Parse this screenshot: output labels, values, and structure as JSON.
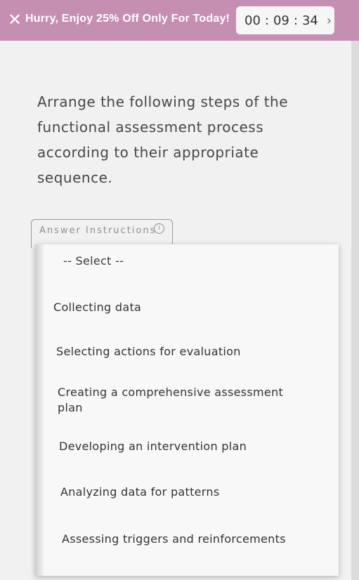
{
  "banner": {
    "close_icon": "close-icon",
    "promo_text": "Hurry, Enjoy 25% Off Only For Today!",
    "timer": {
      "hours": "00",
      "minutes": "09",
      "seconds": "34"
    },
    "chevron_icon": "chevron-right-icon",
    "background_color": "#c48fb0"
  },
  "question": {
    "text": "Arrange the following steps of the functional assessment process according to their appropriate sequence."
  },
  "answer": {
    "label": "Answer Instructions",
    "info_icon": "info-icon"
  },
  "dropdown": {
    "placeholder": "-- Select --",
    "options": [
      "Collecting data",
      "Selecting actions for evaluation",
      "Creating a comprehensive assessment plan",
      "Developing an intervention plan",
      "Analyzing data for patterns",
      "Assessing triggers and reinforcements"
    ]
  }
}
